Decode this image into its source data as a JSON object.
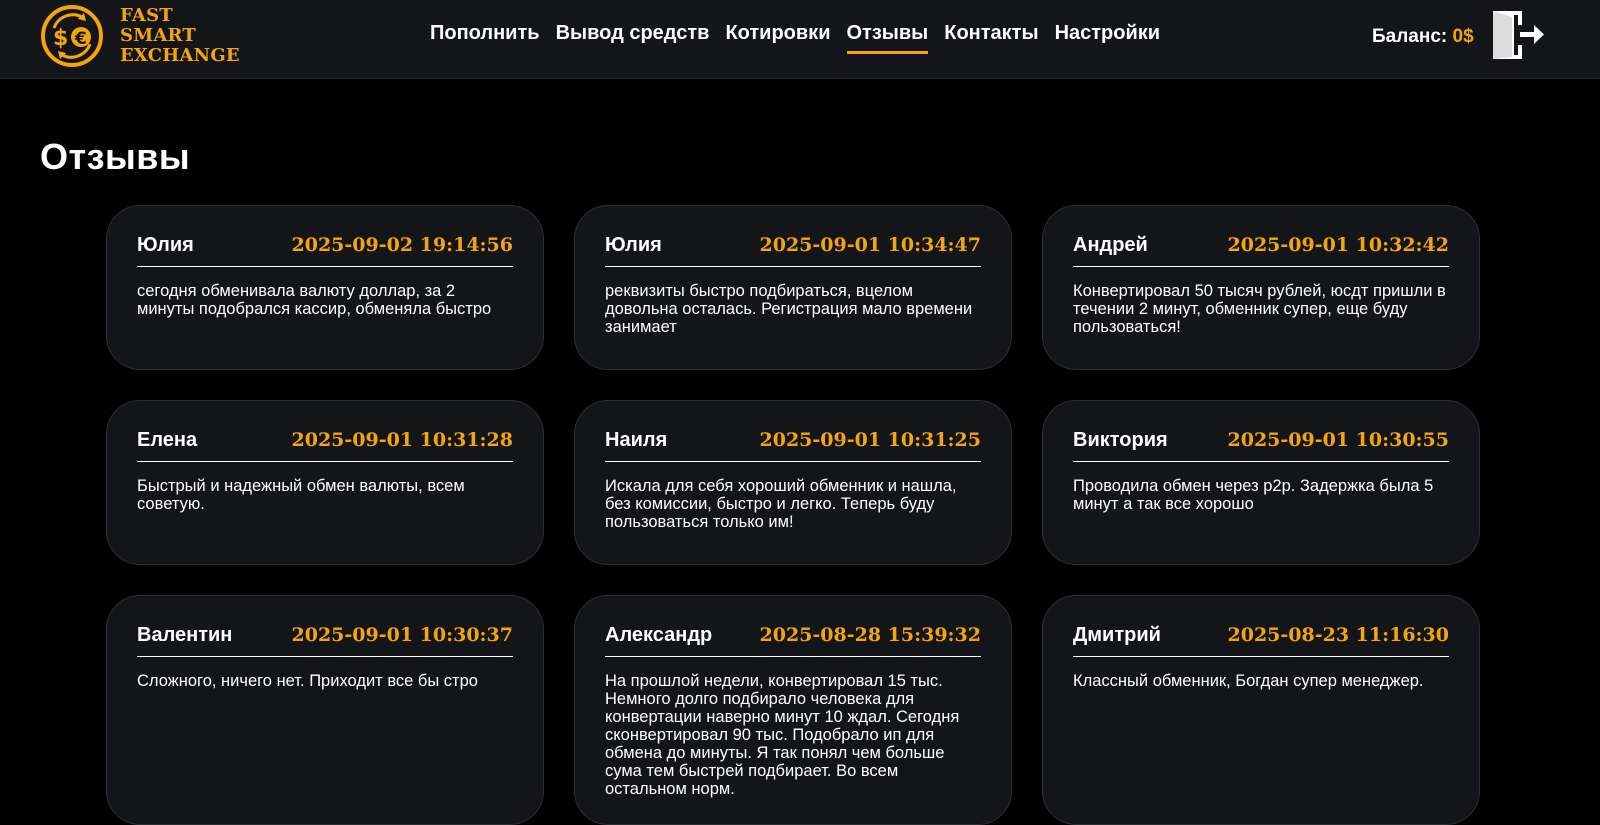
{
  "brand": {
    "lines": [
      "FAST",
      "SMART",
      "EXCHANGE"
    ],
    "accent_color": "#f5a50c",
    "icon": "currency-exchange-icon"
  },
  "nav": {
    "items": [
      {
        "label": "Пополнить",
        "active": false
      },
      {
        "label": "Вывод средств",
        "active": false
      },
      {
        "label": "Котировки",
        "active": false
      },
      {
        "label": "Отзывы",
        "active": true
      },
      {
        "label": "Контакты",
        "active": false
      },
      {
        "label": "Настройки",
        "active": false
      }
    ]
  },
  "account": {
    "balance_label": "Баланс:",
    "balance_value": "0$",
    "logout_icon": "logout-icon"
  },
  "page": {
    "title": "Отзывы"
  },
  "reviews": [
    {
      "name": "Юлия",
      "date": "2025-09-02 19:14:56",
      "text": "сегодня обменивала валюту доллар, за 2 минуты подобрался кассир, обменяла быстро"
    },
    {
      "name": "Юлия",
      "date": "2025-09-01 10:34:47",
      "text": "реквизиты быстро подбираться, вцелом довольна осталась. Регистрация мало времени занимает"
    },
    {
      "name": "Андрей",
      "date": "2025-09-01 10:32:42",
      "text": "Конвертировал 50 тысяч рублей, юсдт пришли в течении 2 минут, обменник супер, еще буду пользоваться!"
    },
    {
      "name": "Елена",
      "date": "2025-09-01 10:31:28",
      "text": "Быстрый и надежный обмен валюты, всем советую."
    },
    {
      "name": "Наиля",
      "date": "2025-09-01 10:31:25",
      "text": "Искала для себя хороший обменник и нашла, без комиссии, быстро и легко. Теперь буду пользоваться только им!"
    },
    {
      "name": "Виктория",
      "date": "2025-09-01 10:30:55",
      "text": "Проводила обмен через р2р. Задержка была 5 минут а так все хорошо"
    },
    {
      "name": "Валентин",
      "date": "2025-09-01 10:30:37",
      "text": "Сложного, ничего нет. Приходит все бы стро"
    },
    {
      "name": "Александр",
      "date": "2025-08-28 15:39:32",
      "text": "На прошлой недели, конвертировал 15 тыс. Немного долго подбирало человека для конвертации наверно минут 10 ждал. Сегодня сконвертировал 90 тыс. Подобрало ип для обмена до минуты. Я так понял чем больше сума тем быстрей подбирает. Во всем остальном норм."
    },
    {
      "name": "Дмитрий",
      "date": "2025-08-23 11:16:30",
      "text": "Классный обменник, Богдан супер менеджер."
    }
  ]
}
